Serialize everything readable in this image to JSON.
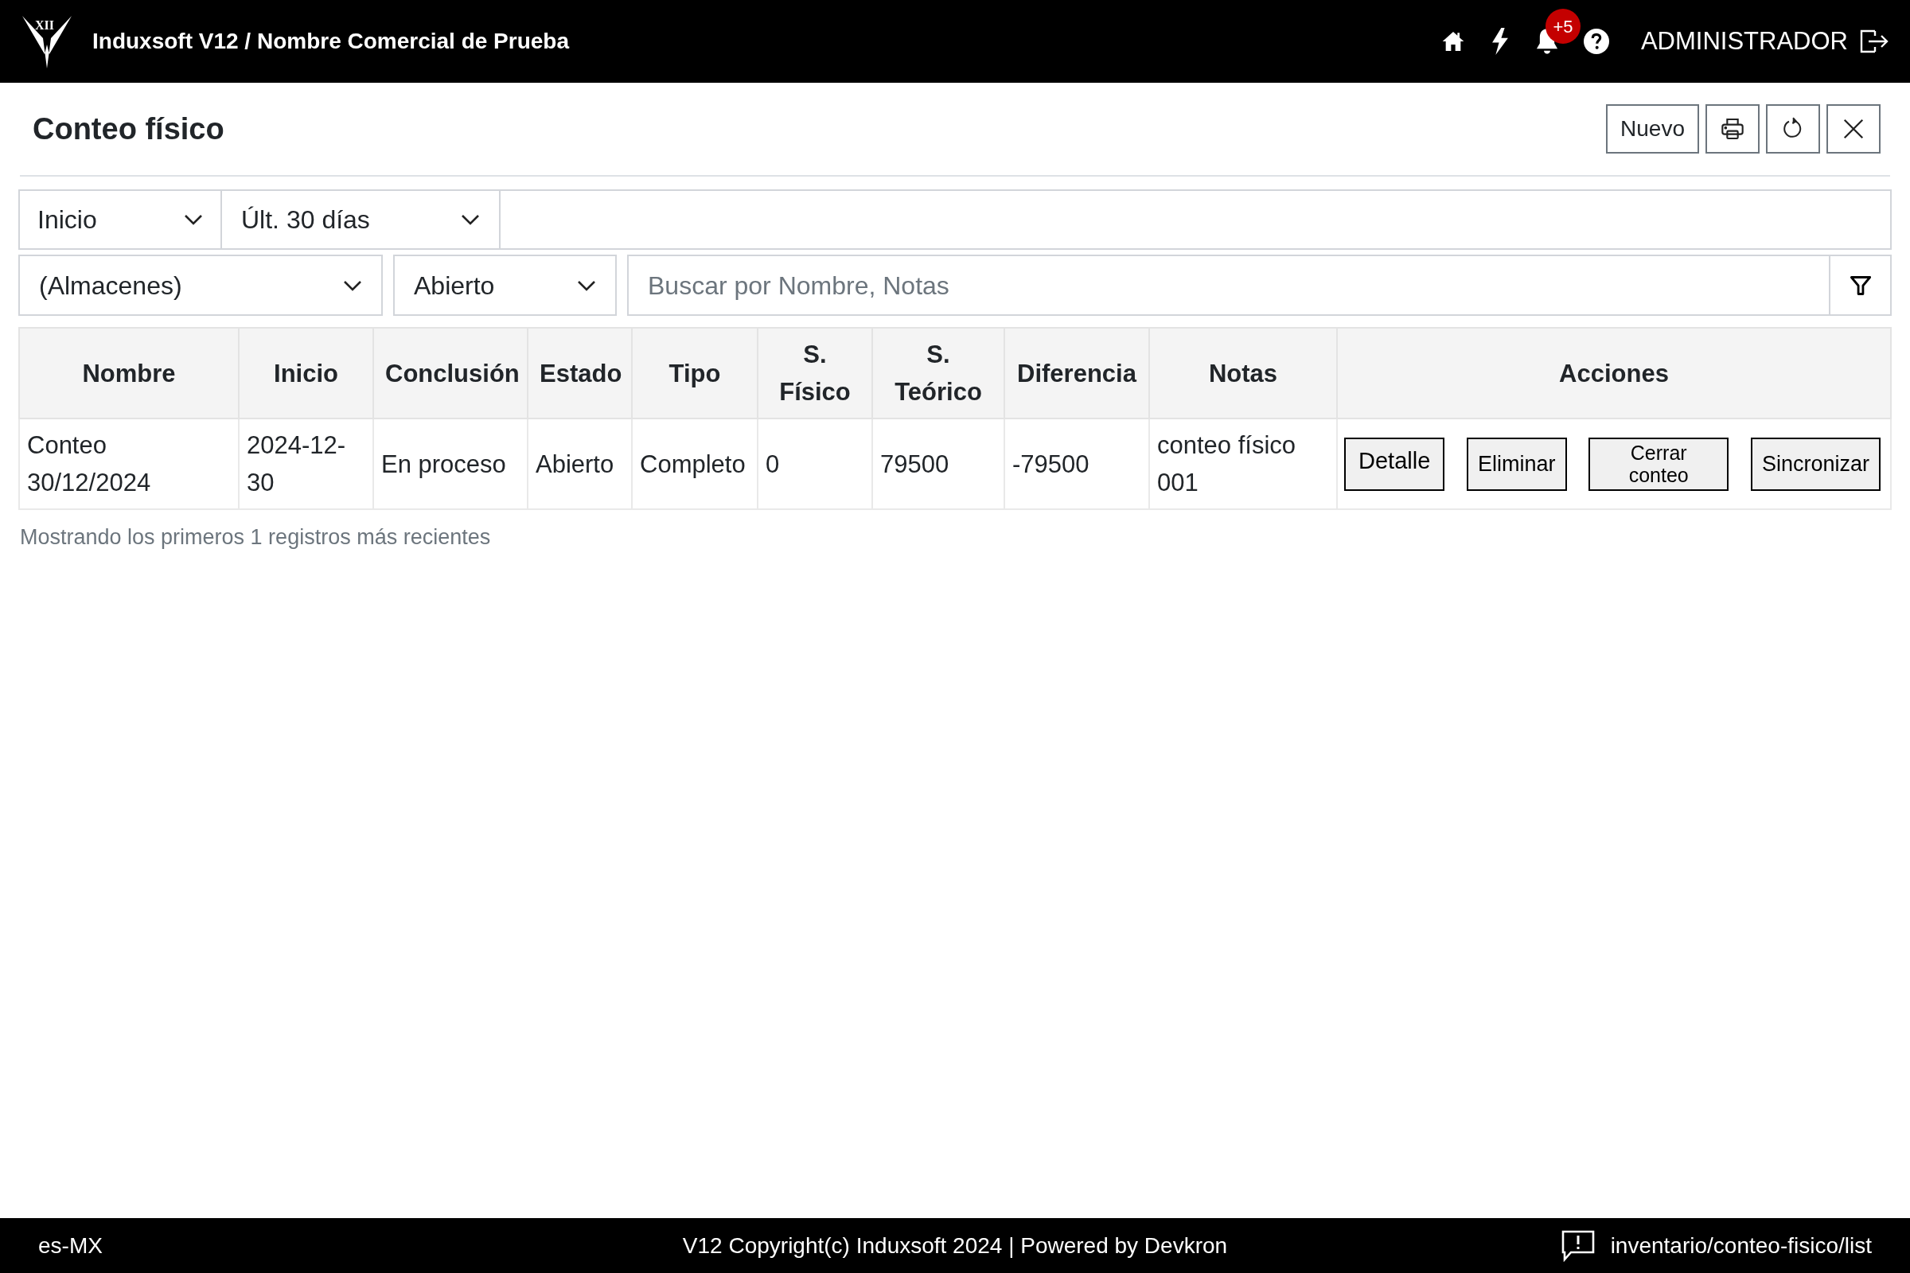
{
  "header": {
    "logo_text": "XII",
    "title": "Induxsoft V12 / Nombre Comercial de Prueba",
    "notification_count": "+5",
    "user": "ADMINISTRADOR"
  },
  "page": {
    "title": "Conteo físico",
    "toolbar": [
      {
        "kind": "text",
        "label": "Nuevo"
      },
      {
        "kind": "print"
      },
      {
        "kind": "refresh"
      },
      {
        "kind": "close"
      }
    ]
  },
  "filters": {
    "date_field": "Inicio",
    "period": "Últ. 30 días",
    "warehouse": "(Almacenes)",
    "status": "Abierto",
    "search": {
      "placeholder": "Buscar por Nombre, Notas"
    }
  },
  "table": {
    "columns": [
      "Nombre",
      "Inicio",
      "Conclusión",
      "Estado",
      "Tipo",
      "S. Físico",
      "S. Teórico",
      "Diferencia",
      "Notas",
      "Acciones"
    ],
    "rows": [
      {
        "cells": [
          "Conteo 30/12/2024",
          "2024-12-30",
          "En proceso",
          "Abierto",
          "Completo",
          "0",
          "79500",
          "-79500",
          "conteo físico 001"
        ],
        "actions": [
          "Detalle",
          "Eliminar",
          "Cerrar conteo",
          "Sincronizar"
        ]
      }
    ]
  },
  "footnote": "Mostrando los primeros 1 registros más recientes",
  "footer": {
    "locale": "es-MX",
    "copyright": "V12 Copyright(c) Induxsoft 2024 | Powered by Devkron",
    "route": "inventario/conteo-fisico/list"
  }
}
